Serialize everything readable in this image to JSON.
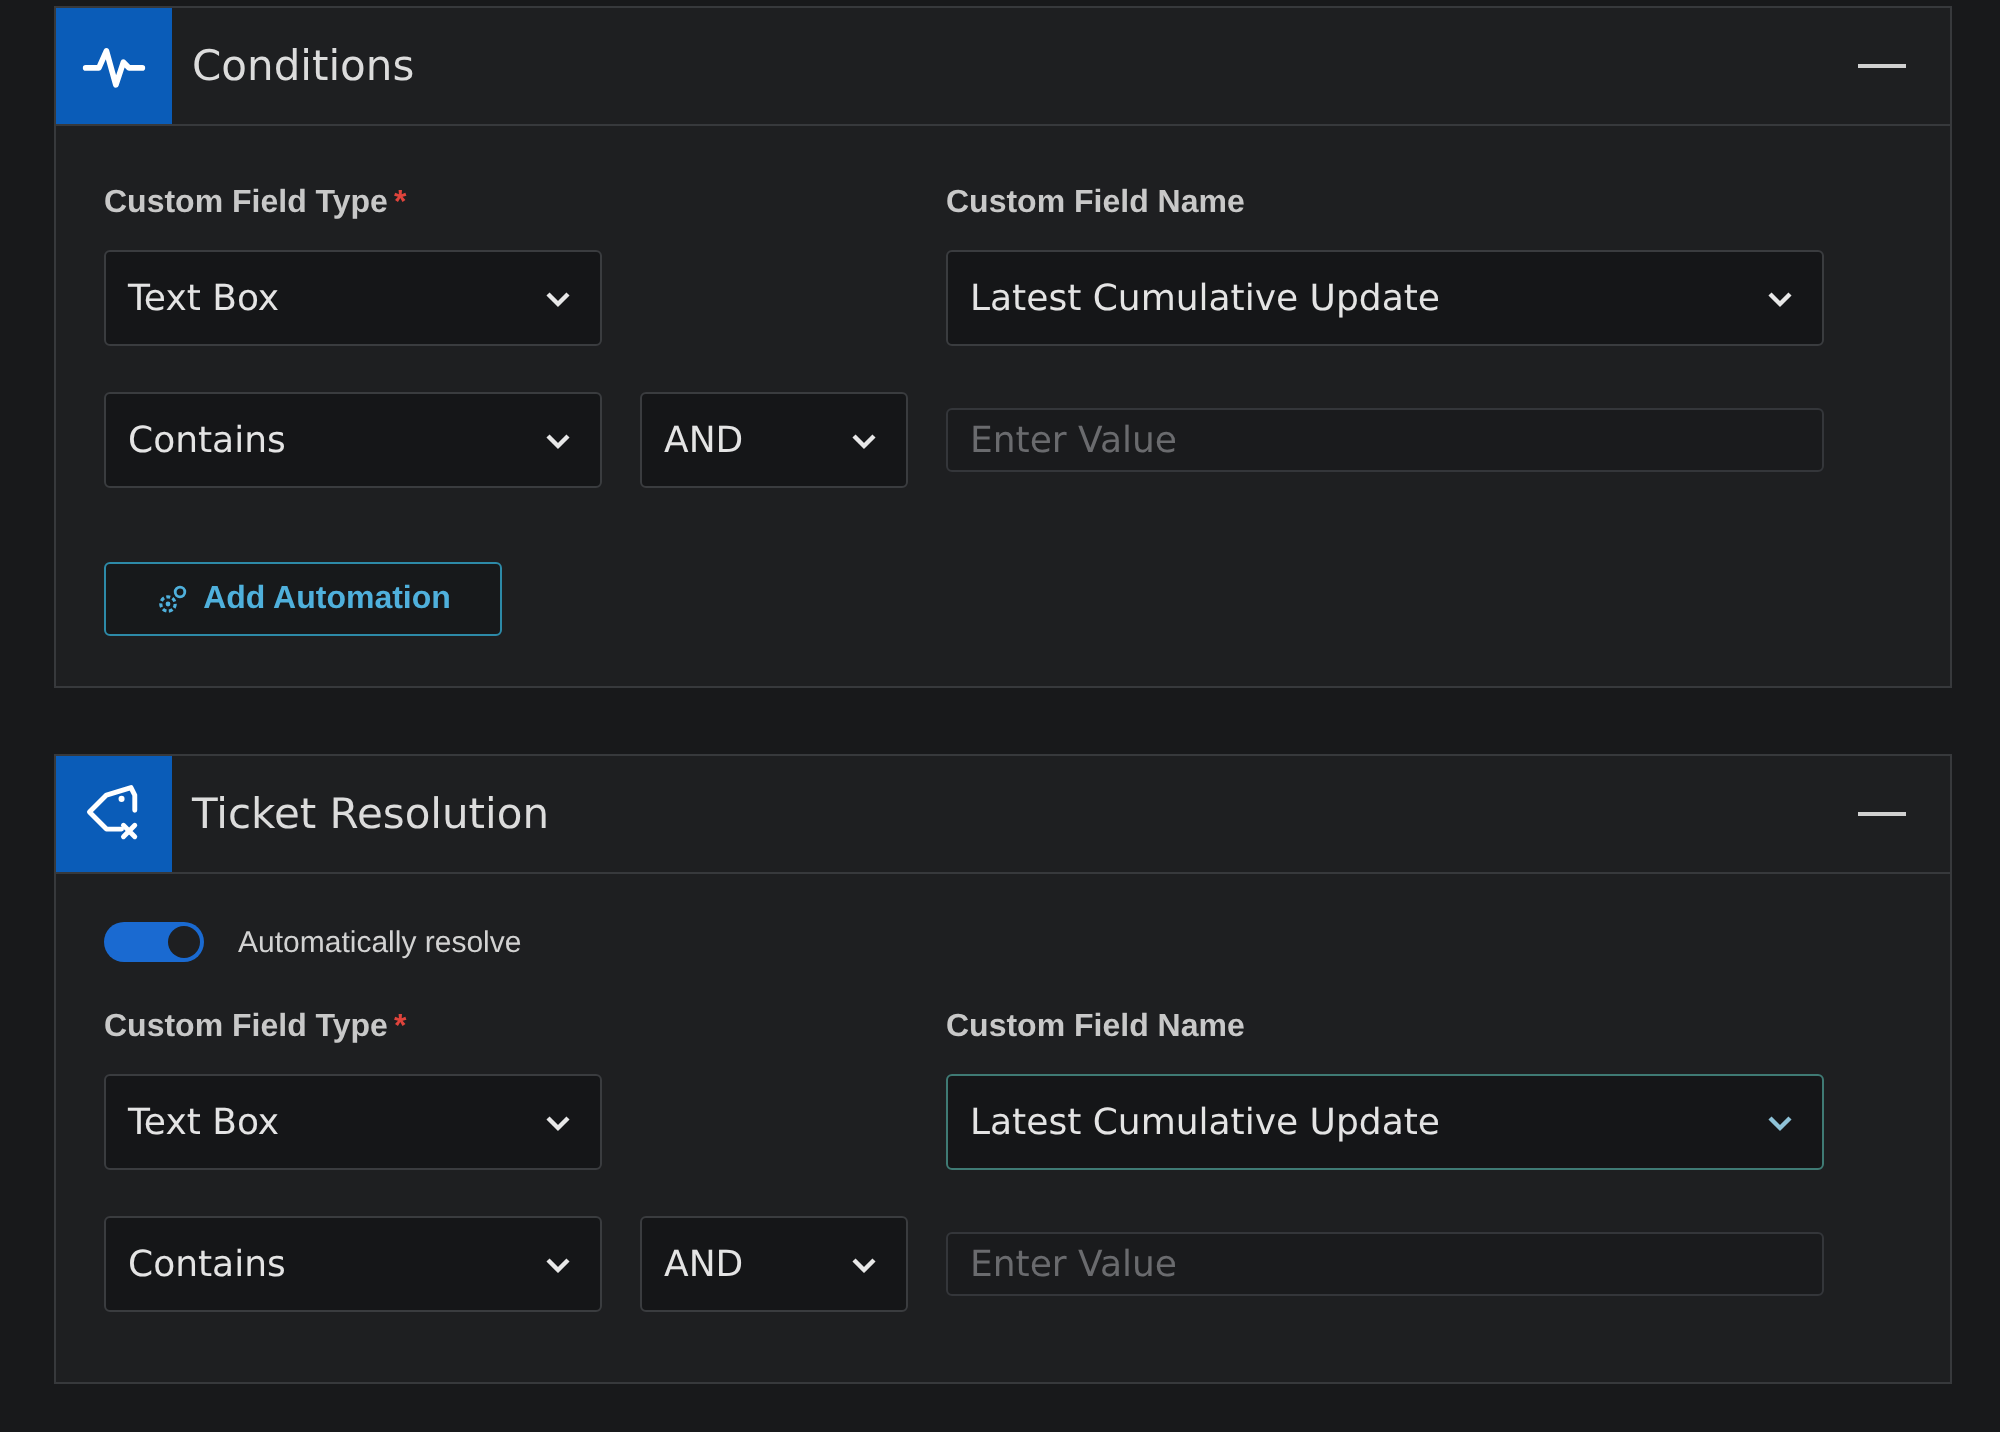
{
  "sections": [
    {
      "title": "Conditions",
      "kind": "pulse",
      "expanded": true,
      "field_type": {
        "label": "Custom Field Type",
        "required": true,
        "required_mark": "*",
        "value": "Text Box"
      },
      "field_name": {
        "label": "Custom Field Name",
        "value": "Latest Cumulative Update",
        "focused": false
      },
      "operator": {
        "value": "Contains"
      },
      "logic": {
        "value": "AND"
      },
      "value_input": {
        "placeholder": "Enter Value"
      },
      "button": {
        "label": "Add Automation"
      }
    },
    {
      "title": "Ticket Resolution",
      "kind": "tag",
      "expanded": true,
      "toggle": {
        "label": "Automatically resolve",
        "on": true
      },
      "field_type": {
        "label": "Custom Field Type",
        "required": true,
        "required_mark": "*",
        "value": "Text Box"
      },
      "field_name": {
        "label": "Custom Field Name",
        "value": "Latest Cumulative Update",
        "focused": true
      },
      "operator": {
        "value": "Contains"
      },
      "logic": {
        "value": "AND"
      },
      "value_input": {
        "placeholder": "Enter Value"
      }
    }
  ]
}
